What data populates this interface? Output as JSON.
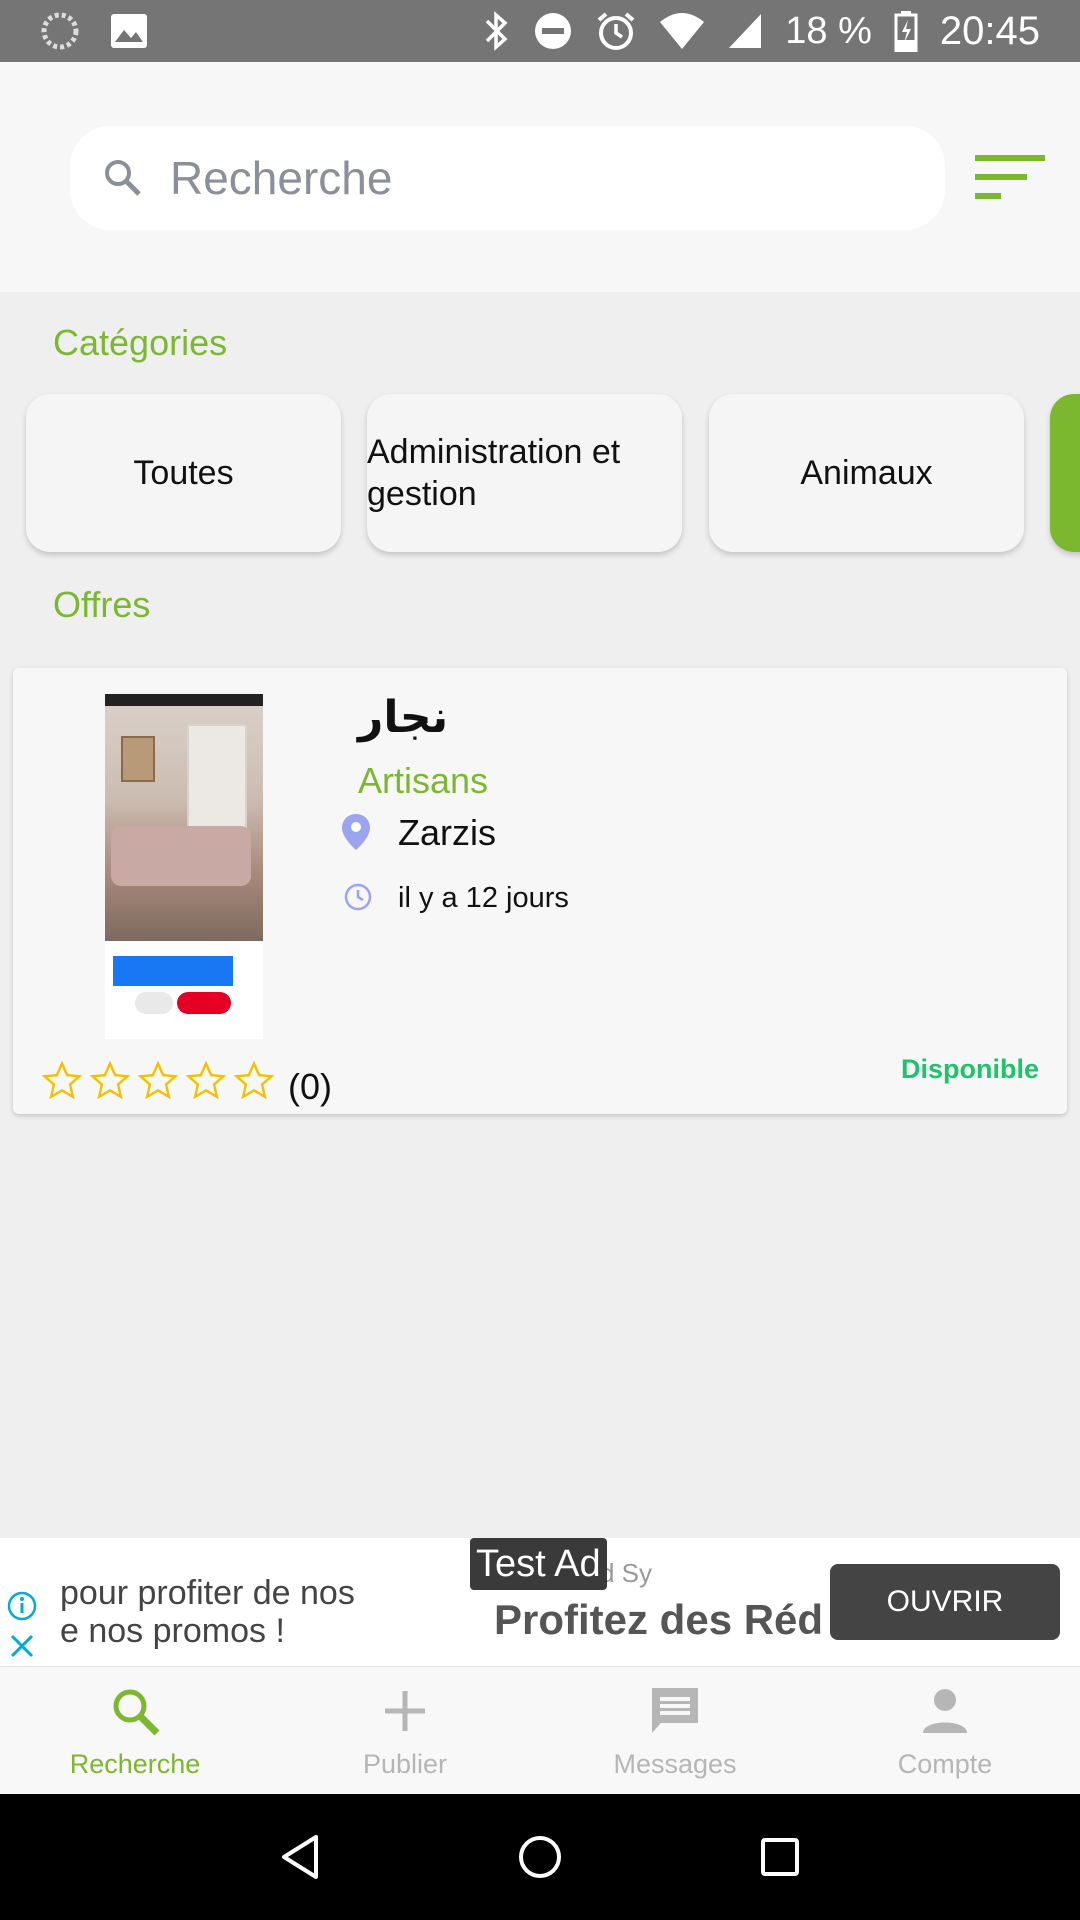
{
  "status_bar": {
    "battery_percent": "18 %",
    "time": "20:45"
  },
  "search": {
    "placeholder": "Recherche",
    "value": ""
  },
  "sections": {
    "categories_title": "Catégories",
    "offers_title": "Offres"
  },
  "categories": [
    {
      "label": "Toutes"
    },
    {
      "label": "Administration et gestion"
    },
    {
      "label": "Animaux"
    }
  ],
  "offer": {
    "title": "نجار",
    "category": "Artisans",
    "location": "Zarzis",
    "posted": "il y a 12 jours",
    "rating_count": "(0)",
    "stars_filled": 0,
    "stars_total": 5,
    "availability": "Disponible"
  },
  "ad": {
    "text_line1": "pour profiter de nos",
    "text_line2": "e nos promos !",
    "sub": "d Sy",
    "headline": "Profitez des Réd",
    "tag": "Test Ad",
    "button": "OUVRIR"
  },
  "bottom_nav": [
    {
      "label": "Recherche",
      "icon": "search-icon",
      "active": true
    },
    {
      "label": "Publier",
      "icon": "plus-icon",
      "active": false
    },
    {
      "label": "Messages",
      "icon": "message-icon",
      "active": false
    },
    {
      "label": "Compte",
      "icon": "account-icon",
      "active": false
    }
  ],
  "colors": {
    "accent": "#7cb82f",
    "available": "#1ec36b",
    "status_bar": "#757575"
  }
}
